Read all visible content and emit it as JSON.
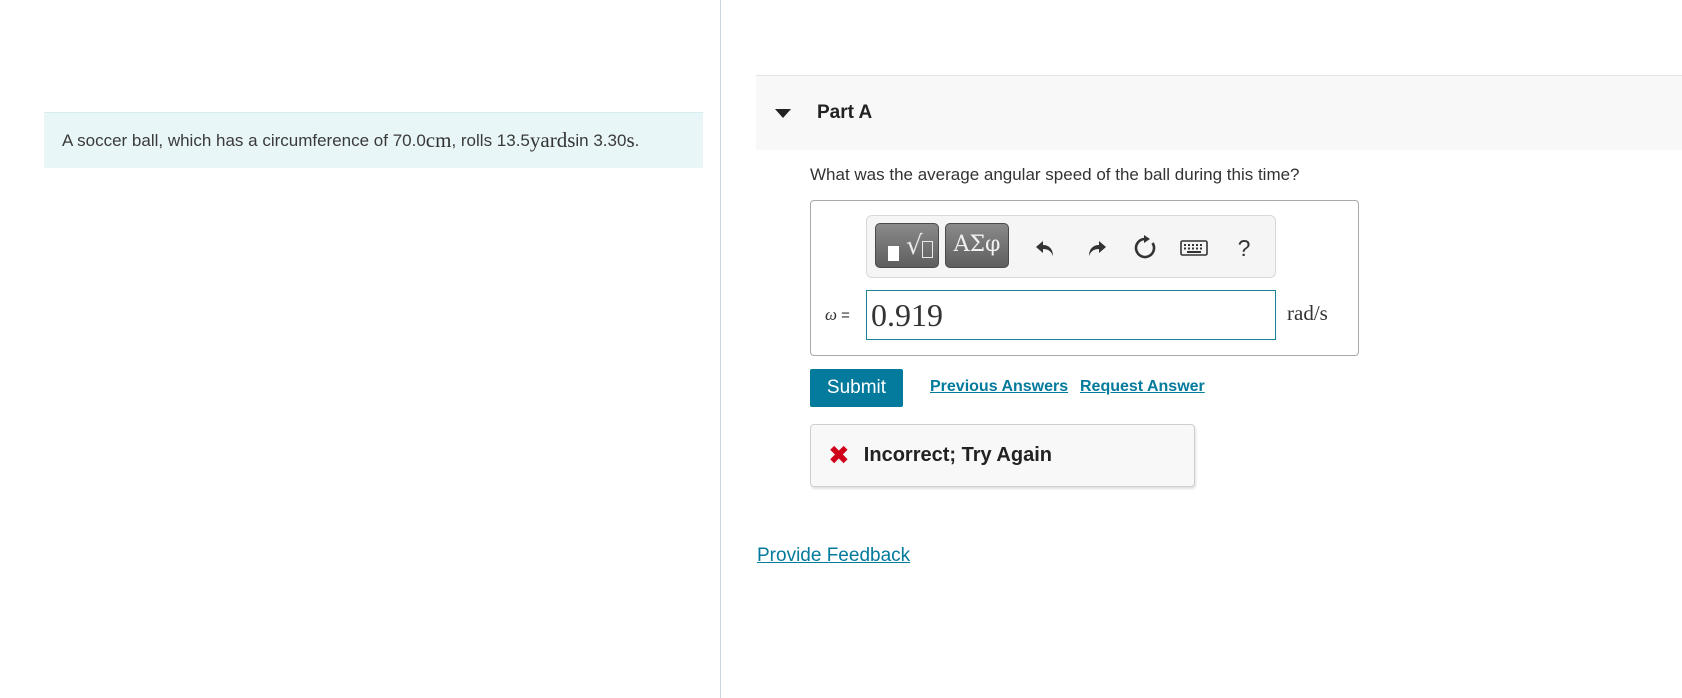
{
  "problem": {
    "text_before_cm": "A soccer ball, which has a circumference of 70.0 ",
    "unit_cm": "cm",
    "text_before_yards": ", rolls 13.5 ",
    "unit_yards": "yards",
    "text_before_s": " in 3.30 ",
    "unit_s": "s",
    "text_end": " ."
  },
  "part": {
    "title": "Part A",
    "question": "What was the average angular speed of the ball during this time?"
  },
  "toolbar": {
    "greek_label": "ΑΣφ",
    "help_label": "?",
    "icons": [
      "templates-icon",
      "greek-symbols-icon",
      "undo-icon",
      "redo-icon",
      "reset-icon",
      "keyboard-icon",
      "help-icon"
    ]
  },
  "answer": {
    "variable": "ω",
    "equals": " =",
    "value": "0.919",
    "unit": "rad/s"
  },
  "actions": {
    "submit_label": "Submit",
    "previous_answers_label": "Previous Answers",
    "request_answer_label": "Request Answer"
  },
  "feedback": {
    "text": "Incorrect; Try Again",
    "icon": "x-icon",
    "color": "#d0021b"
  },
  "footer": {
    "provide_feedback_label": "Provide Feedback"
  },
  "colors": {
    "accent": "#047a9c",
    "problem_bg": "#e9f6f7"
  }
}
